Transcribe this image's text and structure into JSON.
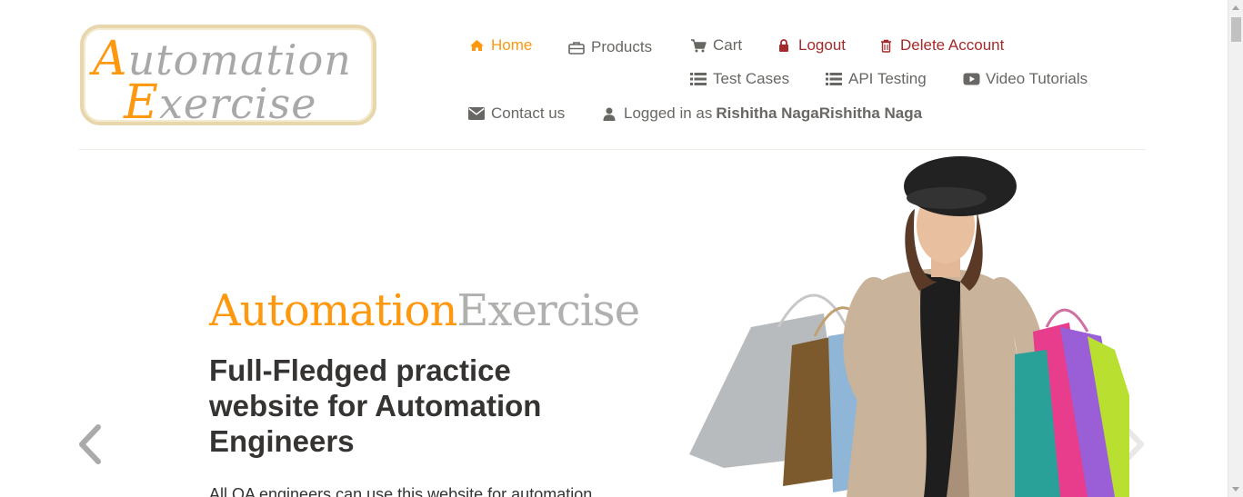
{
  "logo": {
    "line1_cap": "A",
    "line1_rest": "utomation",
    "line2_cap": "E",
    "line2_rest": "xercise"
  },
  "nav": {
    "home": "Home",
    "products": "Products",
    "cart": "Cart",
    "logout": "Logout",
    "delete_account": "Delete Account",
    "test_cases": "Test Cases",
    "api_testing": "API Testing",
    "video_tutorials": "Video Tutorials",
    "contact_us": "Contact us",
    "logged_in_prefix": "Logged in as",
    "logged_in_user": "Rishitha NagaRishitha Naga"
  },
  "hero": {
    "title_orange": "Automation",
    "title_grey": "Exercise",
    "subtitle": "Full-Fledged practice website for Automation Engineers",
    "text": "All QA engineers can use this website for automation"
  },
  "icons": {
    "home": "home-icon",
    "products": "briefcase-icon",
    "cart": "cart-icon",
    "logout": "lock-icon",
    "delete": "trash-icon",
    "test_cases": "list-icon",
    "api": "list-icon",
    "video": "youtube-icon",
    "contact": "envelope-icon",
    "user": "user-icon",
    "prev": "chevron-left-icon",
    "next": "chevron-right-icon"
  },
  "colors": {
    "accent": "#fe980f",
    "danger": "#a52a2a",
    "text": "#696763",
    "heading": "#363432"
  }
}
